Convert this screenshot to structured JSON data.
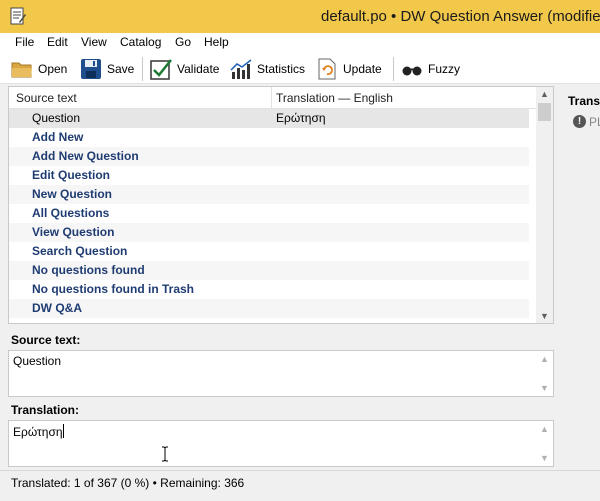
{
  "window": {
    "title": "default.po • DW Question Answer (modifie"
  },
  "menu": [
    "File",
    "Edit",
    "View",
    "Catalog",
    "Go",
    "Help"
  ],
  "toolbar": {
    "open_label": "Open",
    "save_label": "Save",
    "validate_label": "Validate",
    "statistics_label": "Statistics",
    "update_label": "Update",
    "fuzzy_label": "Fuzzy"
  },
  "list": {
    "col_source": "Source text",
    "col_translation": "Translation — English",
    "rows": [
      {
        "source": "Question",
        "translation": "Ερώτηση"
      },
      {
        "source": "Add New",
        "translation": ""
      },
      {
        "source": "Add New Question",
        "translation": ""
      },
      {
        "source": "Edit Question",
        "translation": ""
      },
      {
        "source": "New Question",
        "translation": ""
      },
      {
        "source": "All Questions",
        "translation": ""
      },
      {
        "source": "View Question",
        "translation": ""
      },
      {
        "source": "Search Question",
        "translation": ""
      },
      {
        "source": "No questions found",
        "translation": ""
      },
      {
        "source": "No questions found in Trash",
        "translation": ""
      },
      {
        "source": "DW Q&A",
        "translation": ""
      }
    ]
  },
  "source_section": {
    "label": "Source text:",
    "value": "Question"
  },
  "translation_section": {
    "label": "Translation:",
    "value": "Ερώτηση"
  },
  "status": {
    "text": "Translated: 1 of 367 (0 %)  •  Remaining: 366"
  },
  "side_panel": {
    "title": "Transl",
    "item": "PL"
  },
  "colors": {
    "titlebar": "#f2c84b",
    "untranslated_text": "#1f3c72"
  }
}
